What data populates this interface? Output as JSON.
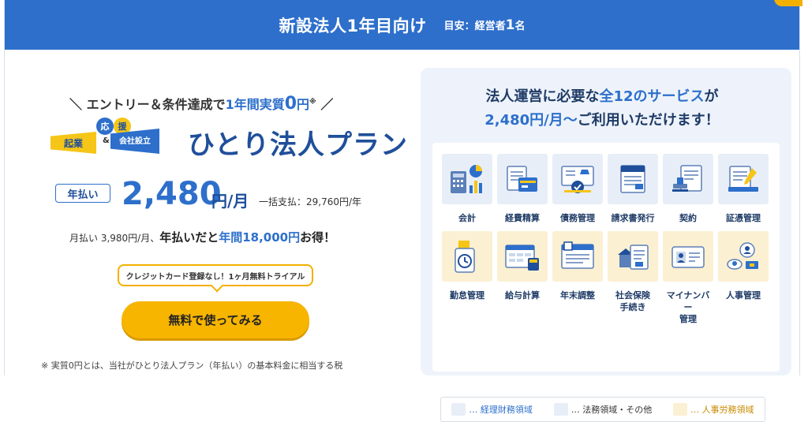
{
  "header": {
    "title": "新設法人1年目向け",
    "sub_label": "目安：経営者",
    "sub_num": "1",
    "sub_suffix": "名"
  },
  "left": {
    "tagline_pre": "＼ エントリー＆条件達成で",
    "tagline_hl": "1年間実質",
    "tagline_big": "0",
    "tagline_yen": "円",
    "tagline_sup": "※",
    "tagline_post": " ／",
    "logo": {
      "kigyo": "起業",
      "ou": "応",
      "en": "援",
      "amp": "&",
      "kaisha": "会社",
      "setsuritsu": "設立"
    },
    "plan_name": "ひとり法人プラン",
    "annual_pill": "年払い",
    "price": "2,480",
    "price_unit": "円/月",
    "lump": "一括支払：29,760円/年",
    "monthly_pre": "月払い 3,980円/月、",
    "monthly_strong": "年払いだと",
    "monthly_blue": "年間18,000円",
    "monthly_post": "お得！",
    "bubble": "クレジットカード登録なし！1ヶ月無料トライアル",
    "cta": "無料で使ってみる",
    "footnote": "※ 実質0円とは、当社がひとり法人プラン（年払い）の基本料金に相当する税"
  },
  "right": {
    "head_line1_pre": "法人運営に必要な",
    "head_line1_blue": "全12のサービス",
    "head_line1_post": "が",
    "head_line2_blue": "2,480円/月～",
    "head_line2_post": "ご利用いただけます！",
    "services": [
      {
        "label": "会計",
        "icon": "accounting-icon"
      },
      {
        "label": "経費精算",
        "icon": "expense-icon"
      },
      {
        "label": "債務管理",
        "icon": "debt-icon"
      },
      {
        "label": "請求書発行",
        "icon": "invoice-icon"
      },
      {
        "label": "契約",
        "icon": "contract-icon"
      },
      {
        "label": "証憑管理",
        "icon": "voucher-icon"
      },
      {
        "label": "勤怠管理",
        "icon": "attendance-icon"
      },
      {
        "label": "給与計算",
        "icon": "payroll-icon"
      },
      {
        "label": "年末調整",
        "icon": "year-end-icon"
      },
      {
        "label": "社会保険\n手続き",
        "icon": "insurance-icon"
      },
      {
        "label": "マイナンバー\n管理",
        "icon": "mynumber-icon"
      },
      {
        "label": "人事管理",
        "icon": "hr-icon"
      }
    ],
    "legend": [
      {
        "label": "… 経理財務領域",
        "color": "#e8eef8"
      },
      {
        "label": "… 法務領域・その他",
        "color": "#e8eef8"
      },
      {
        "label": "… 人事労務領域",
        "color": "#fbf0d2"
      }
    ]
  },
  "colors": {
    "brand_blue": "#2d6fcb",
    "navy": "#1f4f9a",
    "cta_yellow": "#f7b500"
  }
}
